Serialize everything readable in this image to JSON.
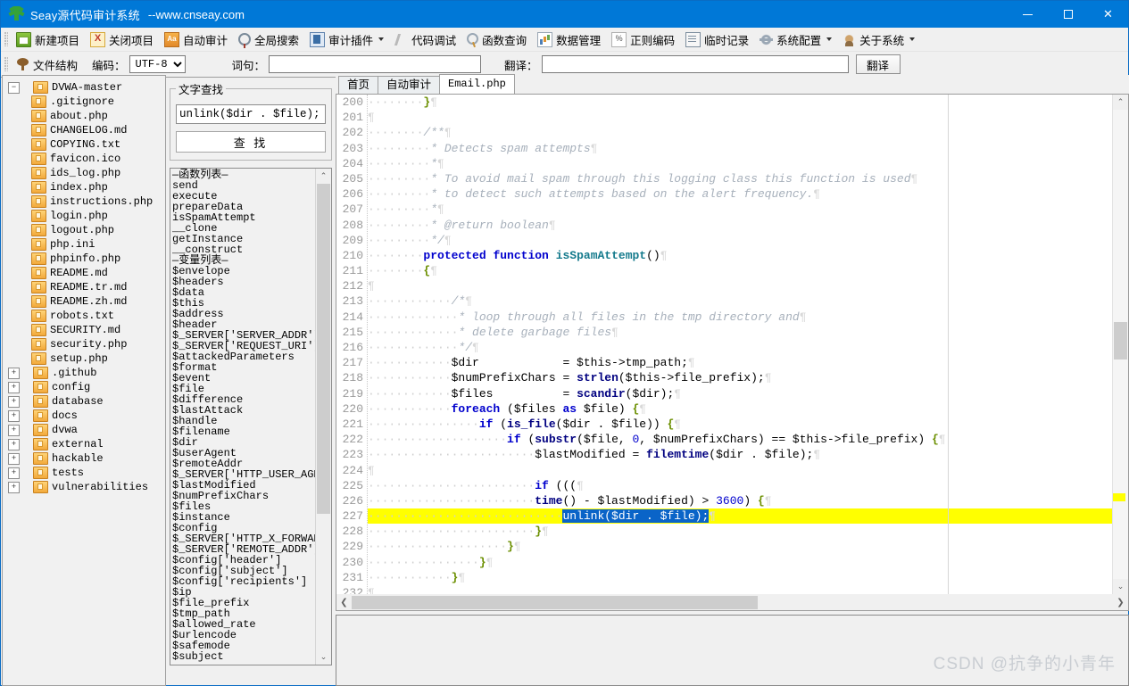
{
  "window": {
    "app_icon": "tree-logo-icon",
    "title": "Seay源代码审计系统",
    "subtitle": "--www.cnseay.com",
    "minimize": "−",
    "maximize": "□",
    "close": "✕",
    "accent": "#0078d7"
  },
  "toolbar": {
    "items": [
      {
        "icon": "new-project-icon",
        "label": "新建项目",
        "caret": false
      },
      {
        "icon": "close-project-icon",
        "label": "关闭项目",
        "caret": false
      },
      {
        "icon": "auto-audit-icon",
        "label": "自动审计",
        "caret": false
      },
      {
        "icon": "global-search-icon",
        "label": "全局搜索",
        "caret": false
      },
      {
        "icon": "audit-plugin-icon",
        "label": "审计插件",
        "caret": true
      },
      {
        "icon": "code-debug-icon",
        "label": "代码调试",
        "caret": false
      },
      {
        "icon": "function-query-icon",
        "label": "函数查询",
        "caret": false
      },
      {
        "icon": "data-manage-icon",
        "label": "数据管理",
        "caret": false
      },
      {
        "icon": "regex-encode-icon",
        "label": "正则编码",
        "caret": false
      },
      {
        "icon": "temp-note-icon",
        "label": "临时记录",
        "caret": false
      },
      {
        "icon": "system-config-icon",
        "label": "系统配置",
        "caret": true
      },
      {
        "icon": "about-system-icon",
        "label": "关于系统",
        "caret": true
      }
    ]
  },
  "row2": {
    "file_structure_label": "文件结构",
    "encoding_label": "编码：",
    "encoding_value": "UTF-8",
    "encoding_options": [
      "UTF-8"
    ],
    "phrase_label": "词句：",
    "phrase_value": "",
    "translate_label": "翻译：",
    "translate_value": "",
    "translate_button": "翻译"
  },
  "tree": {
    "root": {
      "label": "DVWA-master",
      "expander": "−"
    },
    "files": [
      ".gitignore",
      "about.php",
      "CHANGELOG.md",
      "COPYING.txt",
      "favicon.ico",
      "ids_log.php",
      "index.php",
      "instructions.php",
      "login.php",
      "logout.php",
      "php.ini",
      "phpinfo.php",
      "README.md",
      "README.tr.md",
      "README.zh.md",
      "robots.txt",
      "SECURITY.md",
      "security.php",
      "setup.php"
    ],
    "folders": [
      ".github",
      "config",
      "database",
      "docs",
      "dvwa",
      "external",
      "hackable",
      "tests",
      "vulnerabilities"
    ],
    "folder_expander": "+"
  },
  "sidepanel": {
    "find_group_title": "文字查找",
    "find_value": "unlink($dir . $file);",
    "find_button": "查 找",
    "function_list_header": "—函数列表—",
    "functions": [
      "send",
      "execute",
      "prepareData",
      "isSpamAttempt",
      "__clone",
      "getInstance",
      "__construct"
    ],
    "variable_list_header": "—变量列表—",
    "variables": [
      "$envelope",
      "$headers",
      "$data",
      "$this",
      "$address",
      "$header",
      "$_SERVER['SERVER_ADDR']",
      "$_SERVER['REQUEST_URI']",
      "$attackedParameters",
      "$format",
      "$event",
      "$file",
      "$difference",
      "$lastAttack",
      "$handle",
      "$filename",
      "$dir",
      "$userAgent",
      "$remoteAddr",
      "$_SERVER['HTTP_USER_AGENT']",
      "$lastModified",
      "$numPrefixChars",
      "$files",
      "$instance",
      "$config",
      "$_SERVER['HTTP_X_FORWARDED_",
      "$_SERVER['REMOTE_ADDR']",
      "$config['header']",
      "$config['subject']",
      "$config['recipients']",
      "$ip",
      "$file_prefix",
      "$tmp_path",
      "$allowed_rate",
      "$urlencode",
      "$safemode",
      "$subject"
    ]
  },
  "tabs": [
    {
      "label": "首页",
      "active": false,
      "mono": false
    },
    {
      "label": "自动审计",
      "active": false,
      "mono": false
    },
    {
      "label": "Email.php",
      "active": true,
      "mono": true
    }
  ],
  "editor": {
    "first_line": 200,
    "highlight_line": 227,
    "selection_text": "unlink($dir . $file);",
    "highlight_color": "#ffff00",
    "selection_color": "#0a64c8",
    "lines": [
      {
        "n": 200,
        "text": "        }"
      },
      {
        "n": 201,
        "text": ""
      },
      {
        "n": 202,
        "text": "        /**"
      },
      {
        "n": 203,
        "text": "         * Detects spam attempts"
      },
      {
        "n": 204,
        "text": "         *"
      },
      {
        "n": 205,
        "text": "         * To avoid mail spam through this logging class this function is used"
      },
      {
        "n": 206,
        "text": "         * to detect such attempts based on the alert frequency."
      },
      {
        "n": 207,
        "text": "         *"
      },
      {
        "n": 208,
        "text": "         * @return boolean"
      },
      {
        "n": 209,
        "text": "         */"
      },
      {
        "n": 210,
        "text": "        protected function isSpamAttempt()"
      },
      {
        "n": 211,
        "text": "        {"
      },
      {
        "n": 212,
        "text": ""
      },
      {
        "n": 213,
        "text": "            /*"
      },
      {
        "n": 214,
        "text": "             * loop through all files in the tmp directory and"
      },
      {
        "n": 215,
        "text": "             * delete garbage files"
      },
      {
        "n": 216,
        "text": "             */"
      },
      {
        "n": 217,
        "text": "            $dir            = $this->tmp_path;"
      },
      {
        "n": 218,
        "text": "            $numPrefixChars = strlen($this->file_prefix);"
      },
      {
        "n": 219,
        "text": "            $files          = scandir($dir);"
      },
      {
        "n": 220,
        "text": "            foreach ($files as $file) {"
      },
      {
        "n": 221,
        "text": "                if (is_file($dir . $file)) {"
      },
      {
        "n": 222,
        "text": "                    if (substr($file, 0, $numPrefixChars) == $this->file_prefix) {"
      },
      {
        "n": 223,
        "text": "                        $lastModified = filemtime($dir . $file);"
      },
      {
        "n": 224,
        "text": ""
      },
      {
        "n": 225,
        "text": "                        if ((("
      },
      {
        "n": 226,
        "text": "                        time() - $lastModified) > 3600) {"
      },
      {
        "n": 227,
        "text": "                            unlink($dir . $file);"
      },
      {
        "n": 228,
        "text": "                        }"
      },
      {
        "n": 229,
        "text": "                    }"
      },
      {
        "n": 230,
        "text": "                }"
      },
      {
        "n": 231,
        "text": "            }"
      },
      {
        "n": 232,
        "text": ""
      }
    ]
  },
  "scrollbars": {
    "up_arrow": "⌃",
    "down_arrow": "⌄",
    "left_arrow": "❮",
    "right_arrow": "❯"
  },
  "output": {
    "text": ""
  },
  "watermark": "CSDN @抗争的小青年"
}
